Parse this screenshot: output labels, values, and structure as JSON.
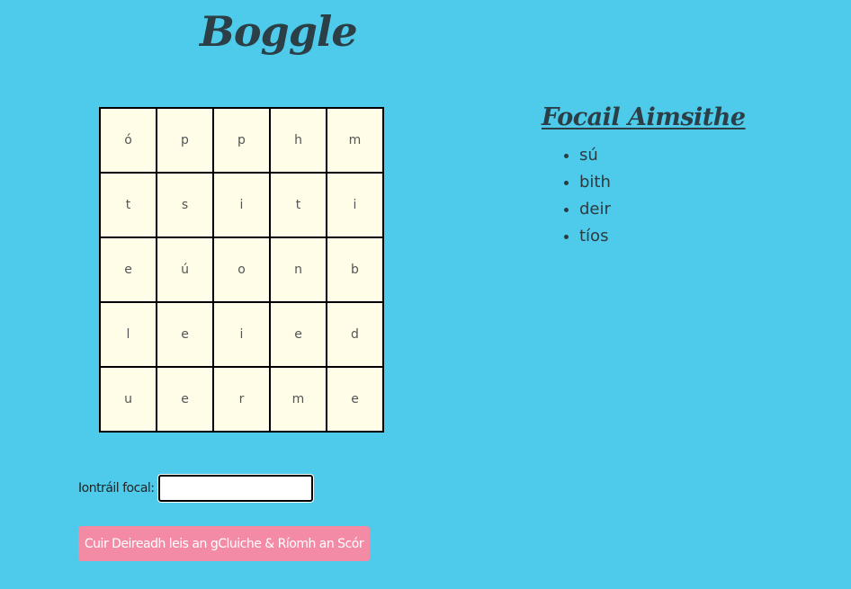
{
  "header": {
    "title": "Boggle"
  },
  "board": {
    "rows": [
      [
        "ó",
        "p",
        "p",
        "h",
        "m"
      ],
      [
        "t",
        "s",
        "i",
        "t",
        "i"
      ],
      [
        "e",
        "ú",
        "o",
        "n",
        "b"
      ],
      [
        "l",
        "e",
        "i",
        "e",
        "d"
      ],
      [
        "u",
        "e",
        "r",
        "m",
        "e"
      ]
    ]
  },
  "found_words": {
    "heading": "Focail Aimsithe",
    "words": [
      "sú",
      "bith",
      "deir",
      "tíos"
    ]
  },
  "entry": {
    "label": "Iontráil focal:",
    "value": ""
  },
  "end_button": {
    "label": "Cuir Deireadh leis an gCluiche & Ríomh an Scór"
  },
  "colors": {
    "background": "#4ecbeb",
    "board_cell": "#fffde7",
    "button": "#f38ba5"
  }
}
